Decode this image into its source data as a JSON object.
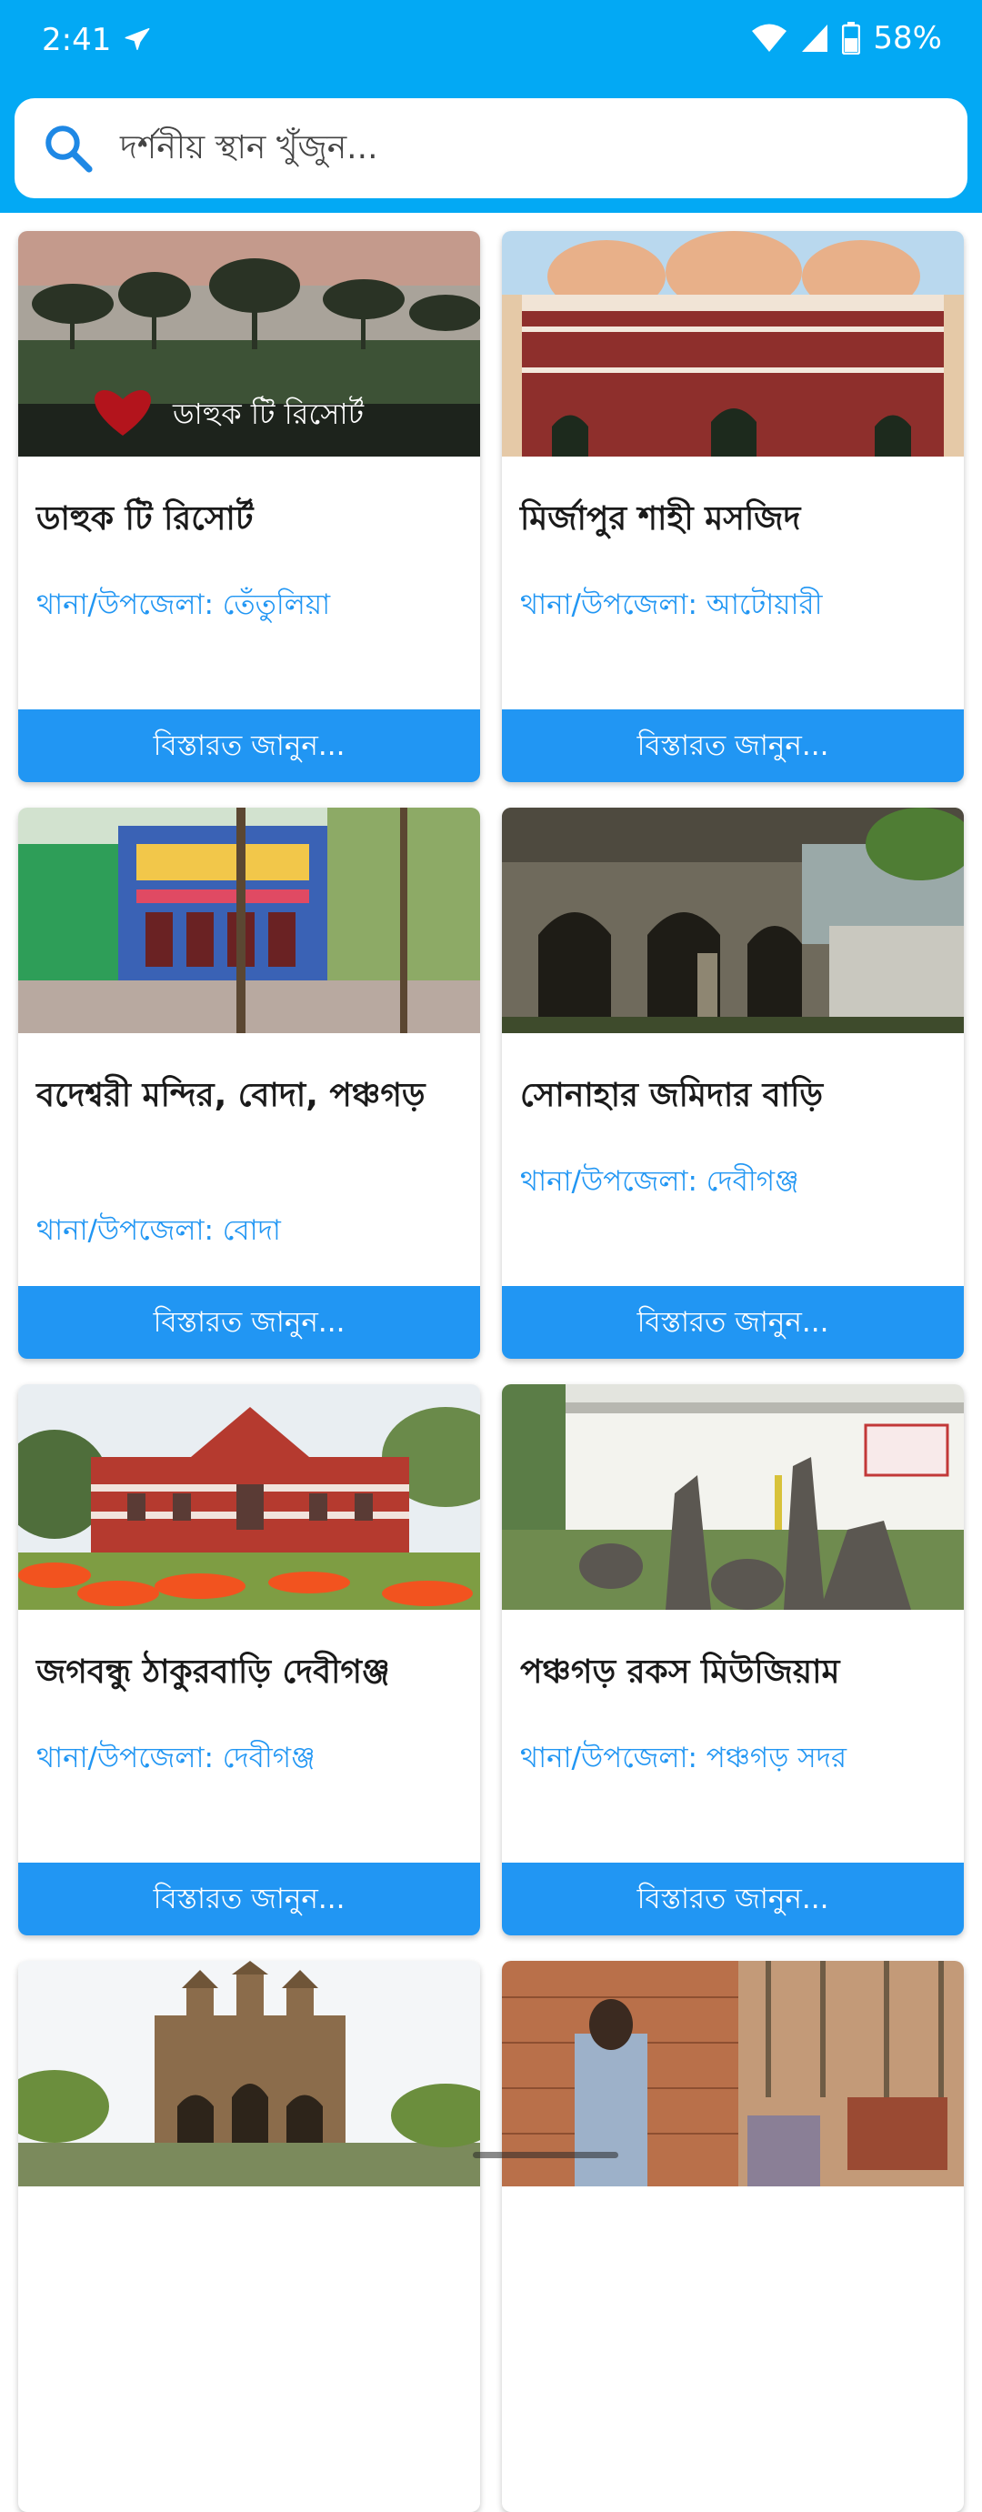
{
  "status_bar": {
    "time": "2:41",
    "battery": "58%",
    "icons": [
      "airplane-icon",
      "wifi-icon",
      "signal-icon",
      "battery-icon"
    ]
  },
  "search": {
    "placeholder": "দর্শনীয় স্থান খুঁজুন...",
    "icon": "search-icon"
  },
  "colors": {
    "header": "#03a9f4",
    "accent": "#2196f3",
    "title_text": "#1a1a1a"
  },
  "places": [
    {
      "title": "ডাহুক টি রিসোর্ট",
      "location": "থানা/উপজেলা: তেঁতুলিয়া",
      "button": "বিস্তারত জানুন...",
      "image_text": "ডাহুক টি রিসোর্ট"
    },
    {
      "title": "মির্জাপুর শাহী মসজিদ",
      "location": "থানা/উপজেলা: আটোয়ারী",
      "button": "বিস্তারত জানুন..."
    },
    {
      "title": "বদেশ্বরী মন্দির, বোদা, পঞ্চগড়",
      "location": "থানা/উপজেলা: বোদা",
      "button": "বিস্তারত জানুন..."
    },
    {
      "title": "সোনাহার জমিদার বাড়ি",
      "location": "থানা/উপজেলা: দেবীগঞ্জ",
      "button": "বিস্তারত জানুন..."
    },
    {
      "title": "জগবন্ধু ঠাকুরবাড়ি দেবীগঞ্জ",
      "location": "থানা/উপজেলা: দেবীগঞ্জ",
      "button": "বিস্তারত জানুন..."
    },
    {
      "title": "পঞ্চগড় রকস মিউজিয়াম",
      "location": "থানা/উপজেলা: পঞ্চগড় সদর",
      "button": "বিস্তারত জানুন..."
    }
  ]
}
